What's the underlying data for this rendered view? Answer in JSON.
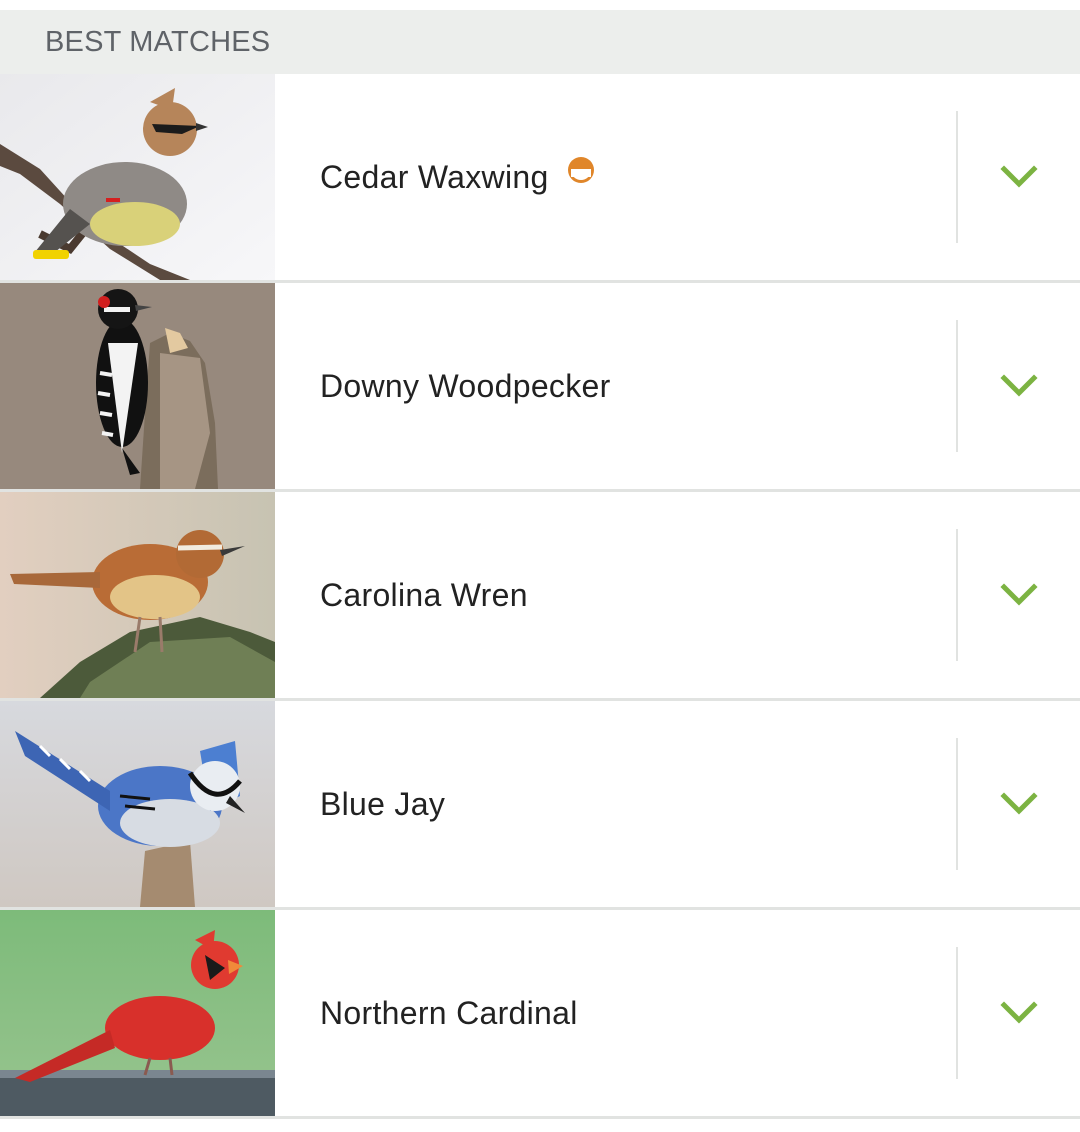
{
  "section": {
    "title": "BEST MATCHES"
  },
  "colors": {
    "header_bg": "#eceeec",
    "header_text": "#5f6368",
    "chevron": "#7cb342",
    "status_orange": "#e0862a",
    "divider": "#e1e3e1"
  },
  "matches": [
    {
      "name": "Cedar Waxwing",
      "photo": "cedar-waxwing-photo",
      "status_icon": "conservation-status-icon",
      "expand_icon": "chevron-down-icon"
    },
    {
      "name": "Downy Woodpecker",
      "photo": "downy-woodpecker-photo",
      "expand_icon": "chevron-down-icon"
    },
    {
      "name": "Carolina Wren",
      "photo": "carolina-wren-photo",
      "expand_icon": "chevron-down-icon"
    },
    {
      "name": "Blue Jay",
      "photo": "blue-jay-photo",
      "expand_icon": "chevron-down-icon"
    },
    {
      "name": "Northern Cardinal",
      "photo": "northern-cardinal-photo",
      "expand_icon": "chevron-down-icon"
    }
  ]
}
